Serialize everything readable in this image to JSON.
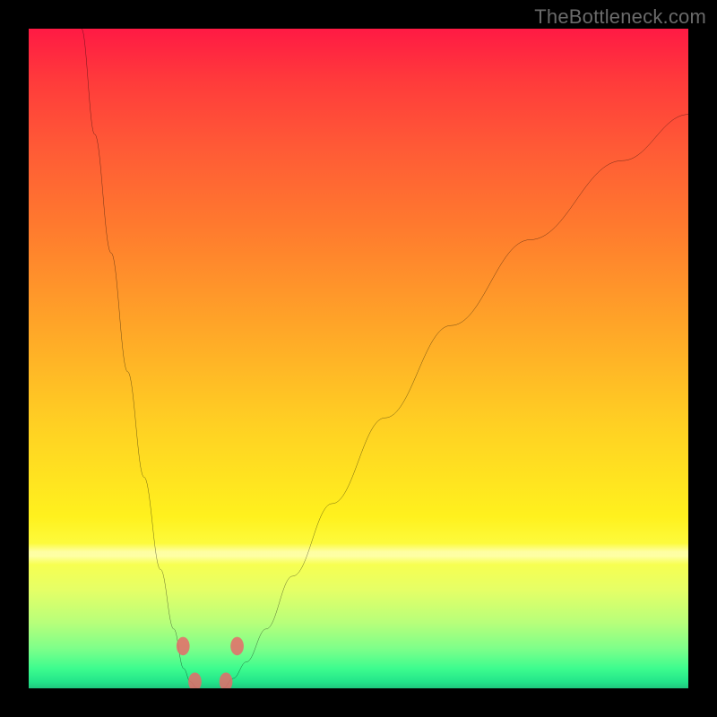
{
  "watermark": "TheBottleneck.com",
  "chart_data": {
    "type": "line",
    "title": "",
    "xlabel": "",
    "ylabel": "",
    "xlim": [
      0,
      100
    ],
    "ylim": [
      0,
      100
    ],
    "background_gradient": {
      "top": "#ff1a44",
      "mid_upper": "#ff7a2e",
      "mid": "#ffd023",
      "mid_lower": "#fcff4a",
      "bottom": "#1fc77e"
    },
    "series": [
      {
        "name": "curve-left",
        "x": [
          8,
          10,
          12.5,
          15,
          17.5,
          20,
          22,
          23.5,
          24.5,
          25.5
        ],
        "y": [
          100,
          84,
          66,
          48,
          32,
          18,
          9,
          3,
          1,
          0
        ]
      },
      {
        "name": "curve-right",
        "x": [
          29.5,
          31,
          33,
          36,
          40,
          46,
          54,
          64,
          76,
          90,
          100
        ],
        "y": [
          0,
          1.5,
          4,
          9,
          17,
          28,
          41,
          55,
          68,
          80,
          87
        ]
      }
    ],
    "markers": [
      {
        "x": 23.4,
        "y": 6.4
      },
      {
        "x": 31.6,
        "y": 6.4
      },
      {
        "x": 25.2,
        "y": 1.0
      },
      {
        "x": 29.9,
        "y": 1.0
      }
    ]
  }
}
